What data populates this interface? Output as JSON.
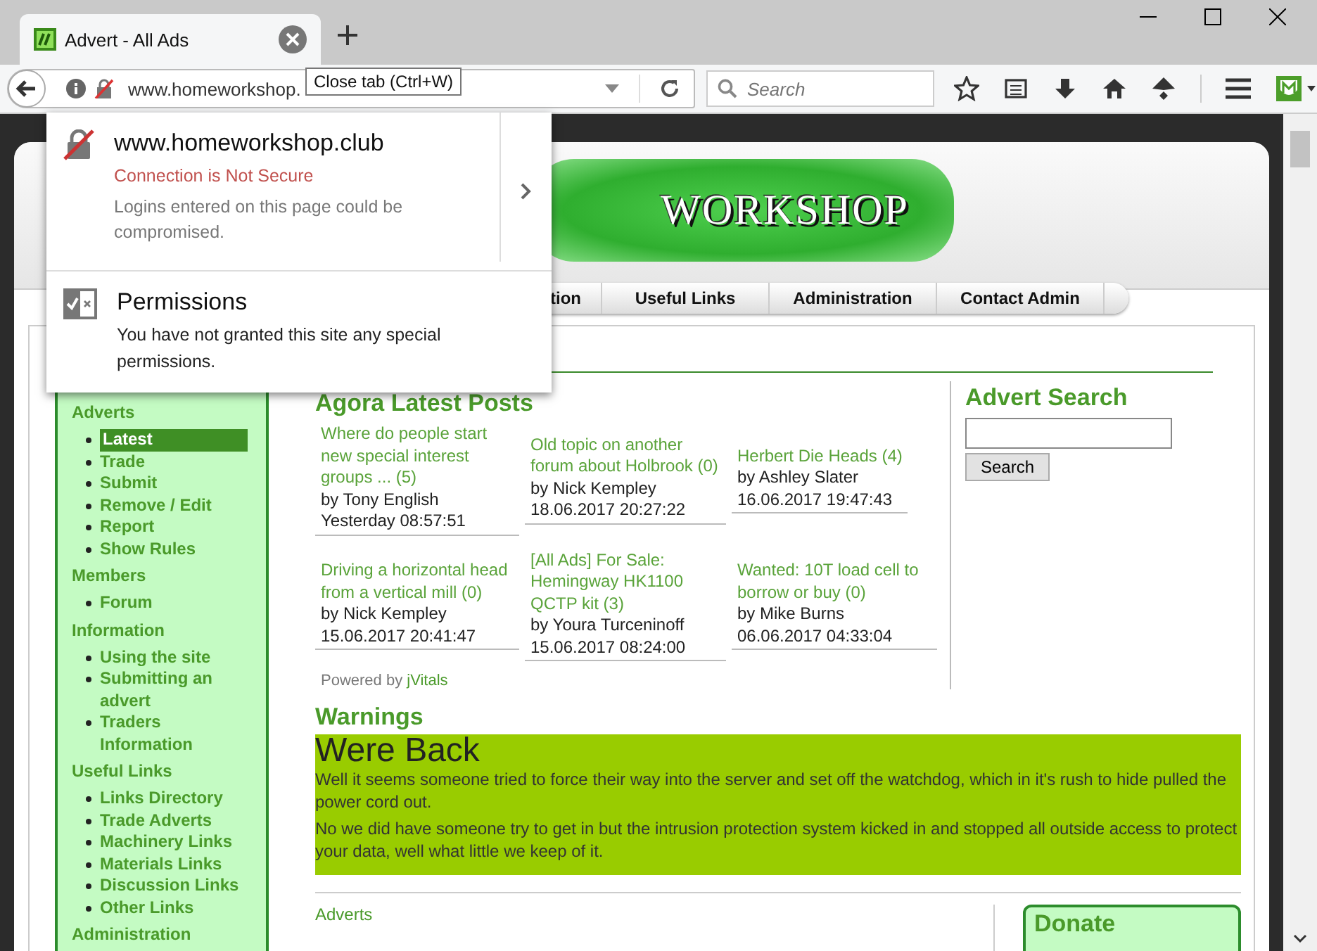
{
  "browser": {
    "tab": {
      "title": "Advert - All Ads"
    },
    "tooltip": "Close tab (Ctrl+W)",
    "url": "www.homeworkshop.",
    "search_placeholder": "Search"
  },
  "site_popup": {
    "host": "www.homeworkshop.club",
    "status": "Connection is Not Secure",
    "warning": "Logins entered on this page could be compromised.",
    "permissions_title": "Permissions",
    "permissions_text": "You have not granted this site any special permissions."
  },
  "site": {
    "logo": "WORKSHOP",
    "nav": [
      {
        "label": "tion"
      },
      {
        "label": "Useful Links"
      },
      {
        "label": "Administration"
      },
      {
        "label": "Contact Admin"
      }
    ],
    "sidebar": [
      {
        "heading": "Adverts",
        "items": [
          {
            "label": "Latest",
            "selected": true
          },
          {
            "label": "Trade",
            "selected": false
          },
          {
            "label": "Submit",
            "selected": false
          },
          {
            "label": "Remove / Edit",
            "selected": false
          },
          {
            "label": "Report",
            "selected": false
          },
          {
            "label": "Show Rules",
            "selected": false
          }
        ]
      },
      {
        "heading": "Members",
        "items": [
          {
            "label": "Forum",
            "selected": false
          }
        ]
      },
      {
        "heading": "Information",
        "items": [
          {
            "label": "Using the site",
            "selected": false
          },
          {
            "label": "Submitting an advert",
            "selected": false
          },
          {
            "label": "Traders Information",
            "selected": false
          }
        ]
      },
      {
        "heading": "Useful Links",
        "items": [
          {
            "label": "Links Directory",
            "selected": false
          },
          {
            "label": "Trade Adverts",
            "selected": false
          },
          {
            "label": "Machinery Links",
            "selected": false
          },
          {
            "label": "Materials Links",
            "selected": false
          },
          {
            "label": "Discussion Links",
            "selected": false
          },
          {
            "label": "Other Links",
            "selected": false
          }
        ]
      },
      {
        "heading": "Administration"
      }
    ],
    "posts_heading": "Agora Latest Posts",
    "posts": [
      {
        "title": "Where do people start new special interest groups ... (5)",
        "author": "by Tony English",
        "time": "Yesterday 08:57:51"
      },
      {
        "title": "Old topic on another forum about Holbrook (0)",
        "author": "by Nick Kempley",
        "time": "18.06.2017 20:27:22"
      },
      {
        "title": "Herbert Die Heads (4)",
        "author": "by Ashley Slater",
        "time": "16.06.2017 19:47:43"
      },
      {
        "title": "Driving a horizontal head from a vertical mill (0)",
        "author": "by Nick Kempley",
        "time": "15.06.2017 20:41:47"
      },
      {
        "title": "[All Ads] For Sale: Hemingway HK1100 QCTP kit (3)",
        "author": "by Youra Turceninoff",
        "time": "15.06.2017 08:24:00"
      },
      {
        "title": "Wanted: 10T load cell to borrow or buy (0)",
        "author": "by Mike Burns",
        "time": "06.06.2017 04:33:04"
      }
    ],
    "powered_by": "Powered by",
    "powered_link": "jVitals",
    "search": {
      "heading": "Advert Search",
      "button": "Search"
    },
    "warnings": {
      "heading": "Warnings",
      "title": "Were Back",
      "paragraphs": [
        "Well it seems someone tried to force their way into the server and set off the watchdog, which in it's rush to hide pulled the power cord out.",
        "No we did have someone try to get in but the intrusion protection system kicked in and stopped all outside access to protect your data, well what little we keep of it."
      ]
    },
    "adverts_link": "Adverts",
    "donate": "Donate"
  }
}
